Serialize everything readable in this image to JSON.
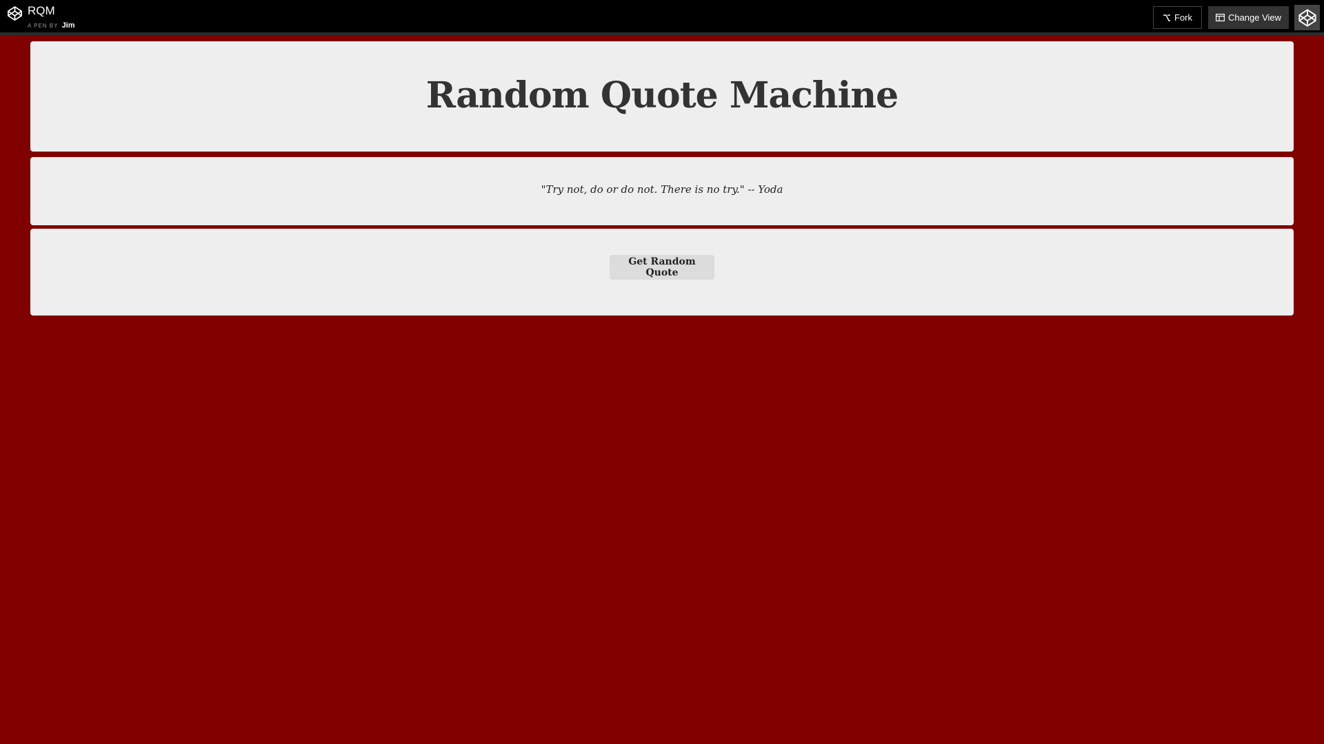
{
  "header": {
    "pen_title": "RQM",
    "pen_by_label": "A PEN BY",
    "author": "Jim",
    "fork_label": "Fork",
    "change_view_label": "Change View"
  },
  "main": {
    "title": "Random Quote Machine",
    "quote": "\"Try not, do or do not. There is no try.\" -- Yoda",
    "button_label": "Get Random Quote"
  },
  "colors": {
    "background": "#800000",
    "card": "#eeeeee",
    "topbar": "#000000"
  }
}
